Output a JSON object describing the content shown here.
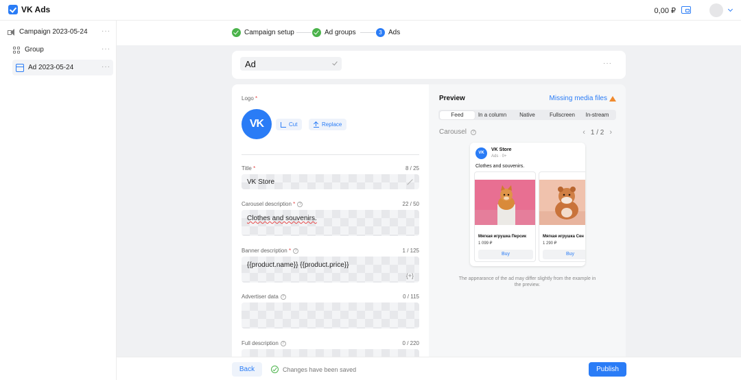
{
  "app": {
    "title": "VK Ads",
    "balance": "0,00 ₽"
  },
  "sidebar": {
    "items": [
      {
        "label": "Campaign 2023-05-24"
      },
      {
        "label": "Group"
      },
      {
        "label": "Ad 2023-05-24"
      }
    ]
  },
  "steps": [
    {
      "label": "Campaign setup",
      "state": "done"
    },
    {
      "label": "Ad groups",
      "state": "done"
    },
    {
      "label": "Ads",
      "state": "current",
      "number": "3"
    }
  ],
  "ad_name": {
    "value": "Ad"
  },
  "form": {
    "logo_label": "Logo",
    "logo_text": "VK",
    "cut_label": "Cut",
    "replace_label": "Replace",
    "title": {
      "label": "Title",
      "count": "8 / 25",
      "value": "VK Store"
    },
    "carousel_description": {
      "label": "Carousel description",
      "count": "22 / 50",
      "value": "Clothes and souvenirs."
    },
    "banner_description": {
      "label": "Banner description",
      "count": "1 / 125",
      "value": "{{product.name}} {{product.price}}",
      "vars_glyph": "{+}"
    },
    "advertiser_data": {
      "label": "Advertiser data",
      "count": "0 / 115",
      "value": ""
    },
    "full_description": {
      "label": "Full description",
      "count": "0 / 220",
      "value": ""
    }
  },
  "preview": {
    "title": "Preview",
    "missing_media": "Missing media files",
    "tabs": [
      {
        "label": "Feed",
        "active": true
      },
      {
        "label": "In a column",
        "active": false
      },
      {
        "label": "Native",
        "active": false
      },
      {
        "label": "Fullscreen",
        "active": false
      },
      {
        "label": "In-stream",
        "active": false
      }
    ],
    "carousel_label": "Carousel",
    "pager": "1 / 2",
    "ad": {
      "logo_text": "VK",
      "name": "VK Store",
      "sub": "Ads · 0+",
      "text": "Clothes and souvenirs.",
      "products": [
        {
          "name": "Мягкая игрушка Персик",
          "price": "1 099 ₽",
          "buy": "Buy"
        },
        {
          "name": "Мягкая игрушка Сен",
          "price": "1 290 ₽",
          "buy": "Buy"
        }
      ]
    },
    "note": "The appearance of the ad may differ slightly from the example in the preview."
  },
  "footer": {
    "back": "Back",
    "saved": "Changes have been saved",
    "publish": "Publish"
  },
  "colors": {
    "accent": "#2a7cf6",
    "success": "#4bb34b",
    "warning": "#f08a2e",
    "background": "#f0f1f3"
  }
}
